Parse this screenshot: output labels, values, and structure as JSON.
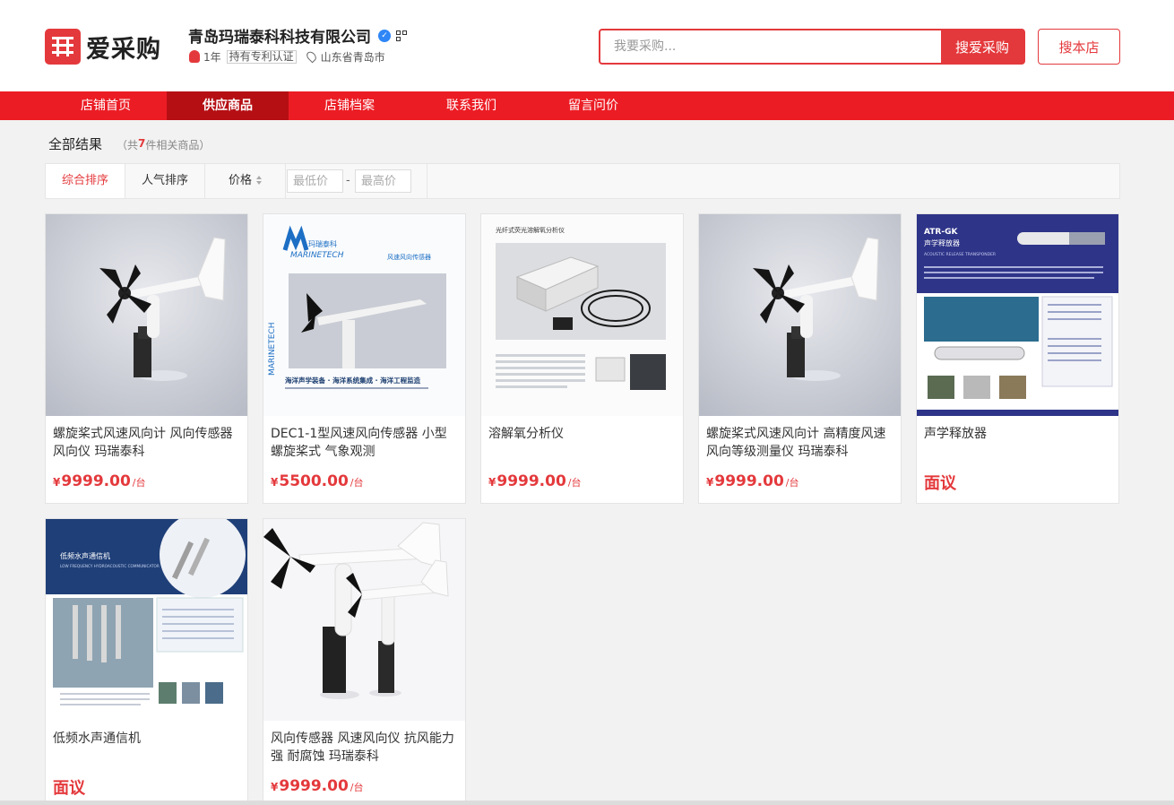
{
  "brand": {
    "logo_text": "爱采购"
  },
  "shop": {
    "name": "青岛玛瑞泰科科技有限公司",
    "years": "1年",
    "patent_tag": "持有专利认证",
    "location": "山东省青岛市"
  },
  "search": {
    "placeholder": "我要采购...",
    "button_label": "搜爱采购",
    "store_button_label": "搜本店"
  },
  "nav": {
    "items": [
      {
        "label": "店铺首页"
      },
      {
        "label": "供应商品"
      },
      {
        "label": "店铺档案"
      },
      {
        "label": "联系我们"
      },
      {
        "label": "留言问价"
      }
    ],
    "active_index": 1
  },
  "results": {
    "title": "全部结果",
    "count_prefix": "（共",
    "count": "7",
    "count_suffix": "件相关商品）"
  },
  "sort": {
    "composite": "综合排序",
    "popularity": "人气排序",
    "price": "价格",
    "min_placeholder": "最低价",
    "max_placeholder": "最高价",
    "dash": "-"
  },
  "products": [
    {
      "title": "螺旋桨式风速风向计 风向传感器 风向仪 玛瑞泰科",
      "yen": "¥",
      "price": "9999.00",
      "unit": "/台",
      "image": "anemometer"
    },
    {
      "title": "DEC1-1型风速风向传感器 小型螺旋桨式 气象观测",
      "yen": "¥",
      "price": "5500.00",
      "unit": "/台",
      "image": "marinetech-brochure",
      "image_text": {
        "brand": "MARINETECH",
        "cn_brand": "玛瑞泰科",
        "caption": "风速风向传感器",
        "slogan": "海洋声学装备 · 海洋系统集成 · 海洋工程监造"
      }
    },
    {
      "title": "溶解氧分析仪",
      "yen": "¥",
      "price": "9999.00",
      "unit": "/台",
      "image": "oxygen-analyzer",
      "image_text": {
        "heading": "光纤式荧光溶解氧分析仪"
      }
    },
    {
      "title": "螺旋桨式风速风向计 高精度风速风向等级测量仪 玛瑞泰科",
      "yen": "¥",
      "price": "9999.00",
      "unit": "/台",
      "image": "anemometer"
    },
    {
      "title": "声学释放器",
      "negotiable": "面议",
      "image": "acoustic-release",
      "image_text": {
        "model": "ATR-GK",
        "cn": "声学释放器",
        "en": "ACOUSTIC RELEASE TRANSPONDER"
      }
    },
    {
      "title": "低频水声通信机",
      "negotiable": "面议",
      "image": "acoustic-modem",
      "image_text": {
        "cn": "低频水声通信机",
        "en": "LOW FREQUENCY HYDROACOUSTIC COMMUNICATOR"
      }
    },
    {
      "title": "风向传感器 风速风向仪 抗风能力强 耐腐蚀 玛瑞泰科",
      "yen": "¥",
      "price": "9999.00",
      "unit": "/台",
      "image": "anemometer-pair"
    }
  ],
  "colors": {
    "brand_red": "#e4393c",
    "nav_red": "#ec1c24",
    "nav_active": "#b50f14"
  }
}
